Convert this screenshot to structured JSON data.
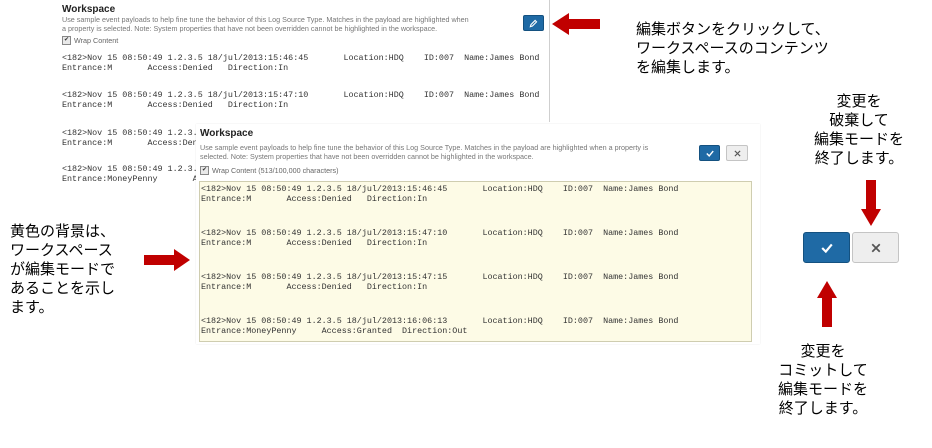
{
  "bg_panel": {
    "title": "Workspace",
    "description": "Use sample event payloads to help fine tune the behavior of this Log Source Type. Matches in the payload are highlighted when a property is selected. Note: System properties that have not been overridden cannot be highlighted in the workspace.",
    "wrap_label": "Wrap Content",
    "edit_icon": "pencil-icon",
    "events": [
      {
        "line1": "<182>Nov 15 08:50:49 1.2.3.5 18/jul/2013:15:46:45       Location:HDQ    ID:007  Name:James Bond",
        "line2": "Entrance:M       Access:Denied   Direction:In"
      },
      {
        "line1": "<182>Nov 15 08:50:49 1.2.3.5 18/jul/2013:15:47:10       Location:HDQ    ID:007  Name:James Bond",
        "line2": "Entrance:M       Access:Denied   Direction:In"
      },
      {
        "line1": "<182>Nov 15 08:50:49 1.2.3.",
        "line2": "Entrance:M       Access:Den"
      },
      {
        "line1": "<182>Nov 15 08:50:49 1.2.3.",
        "line2": "Entrance:MoneyPenny       Acc"
      }
    ]
  },
  "fg_panel": {
    "title": "Workspace",
    "description": "Use sample event payloads to help fine tune the behavior of this Log Source Type. Matches in the payload are highlighted when a property is selected. Note: System properties that have not been overridden cannot be highlighted in the workspace.",
    "wrap_label": "Wrap Content (513/100,000 characters)",
    "commit_icon": "checkmark-icon",
    "discard_icon": "close-icon",
    "events": [
      {
        "line1": "<182>Nov 15 08:50:49 1.2.3.5 18/jul/2013:15:46:45       Location:HDQ    ID:007  Name:James Bond",
        "line2": "Entrance:M       Access:Denied   Direction:In"
      },
      {
        "line1": "<182>Nov 15 08:50:49 1.2.3.5 18/jul/2013:15:47:10       Location:HDQ    ID:007  Name:James Bond",
        "line2": "Entrance:M       Access:Denied   Direction:In"
      },
      {
        "line1": "<182>Nov 15 08:50:49 1.2.3.5 18/jul/2013:15:47:15       Location:HDQ    ID:007  Name:James Bond",
        "line2": "Entrance:M       Access:Denied   Direction:In"
      },
      {
        "line1": "<182>Nov 15 08:50:49 1.2.3.5 18/jul/2013:16:06:13       Location:HDQ    ID:007  Name:James Bond",
        "line2": "Entrance:MoneyPenny     Access:Granted  Direction:Out"
      }
    ]
  },
  "big_buttons": {
    "commit_icon": "checkmark-icon",
    "discard_icon": "close-icon"
  },
  "annotations": {
    "edit_button": "編集ボタンをクリックして、\nワークスペースのコンテンツ\nを編集します。",
    "yellow_bg": "黄色の背景は、\nワークスペース\nが編集モードで\nあることを示し\nます。",
    "discard": "変更を\n破棄して\n編集モードを\n終了します。",
    "commit": "変更を\nコミットして\n編集モードを\n終了します。"
  },
  "colors": {
    "arrow": "#c00000",
    "edit_bg": "#fdfbe6",
    "button_blue": "#1f6aa5"
  }
}
